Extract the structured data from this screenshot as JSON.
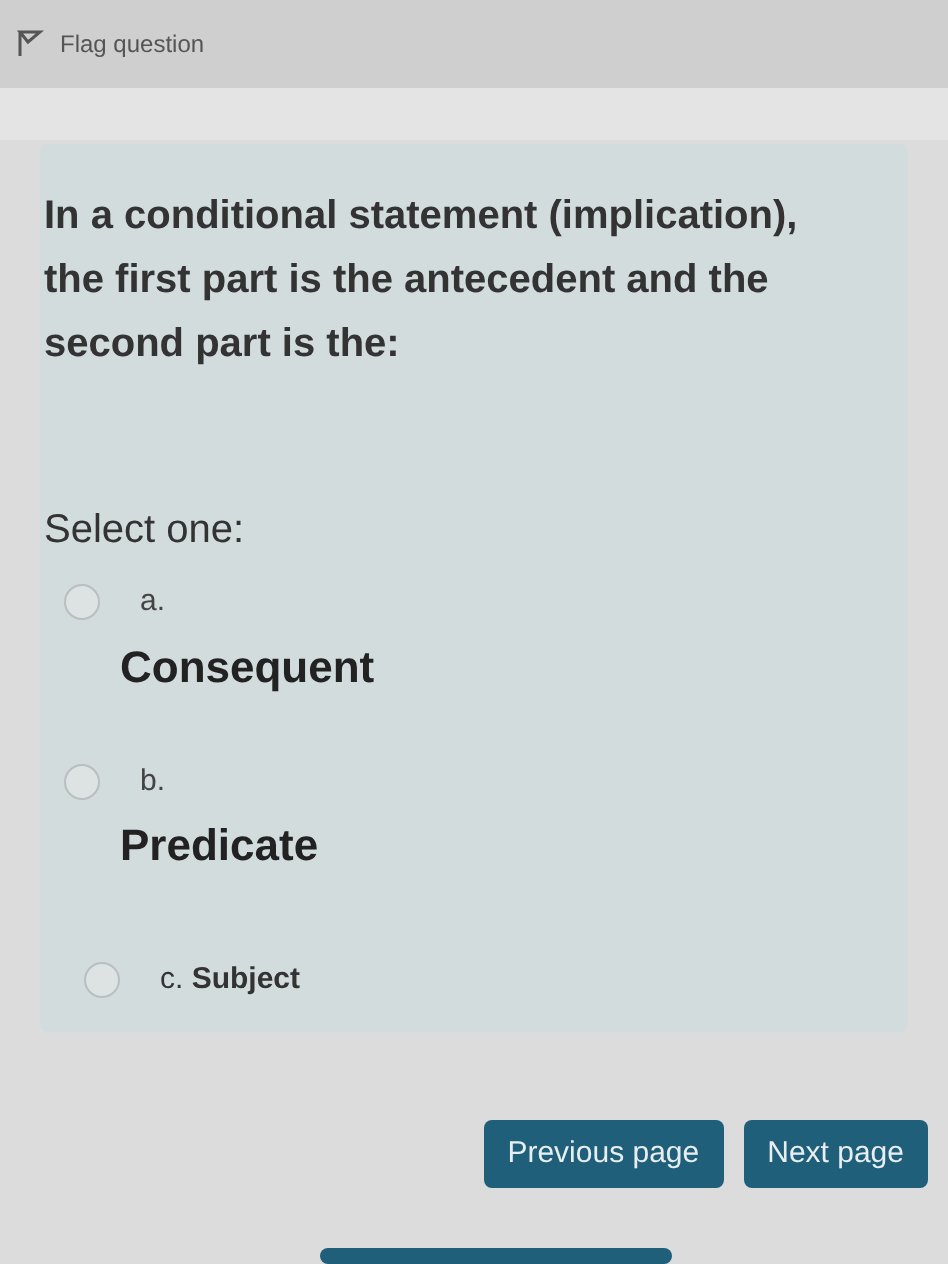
{
  "flag": {
    "label": "Flag question"
  },
  "question": {
    "text": "In a conditional statement (implication), the first part is the antecedent and the second part is the:",
    "prompt": "Select one:",
    "options": [
      {
        "letter": "a.",
        "text": "Consequent",
        "kind": "stacked",
        "selected": false
      },
      {
        "letter": "b.",
        "text": "Predicate",
        "kind": "stacked",
        "selected": false
      },
      {
        "letter": "c.",
        "text": "Subject",
        "kind": "inline",
        "selected": false
      }
    ]
  },
  "navigation": [
    {
      "label": "Previous page"
    },
    {
      "label": "Next page"
    }
  ]
}
